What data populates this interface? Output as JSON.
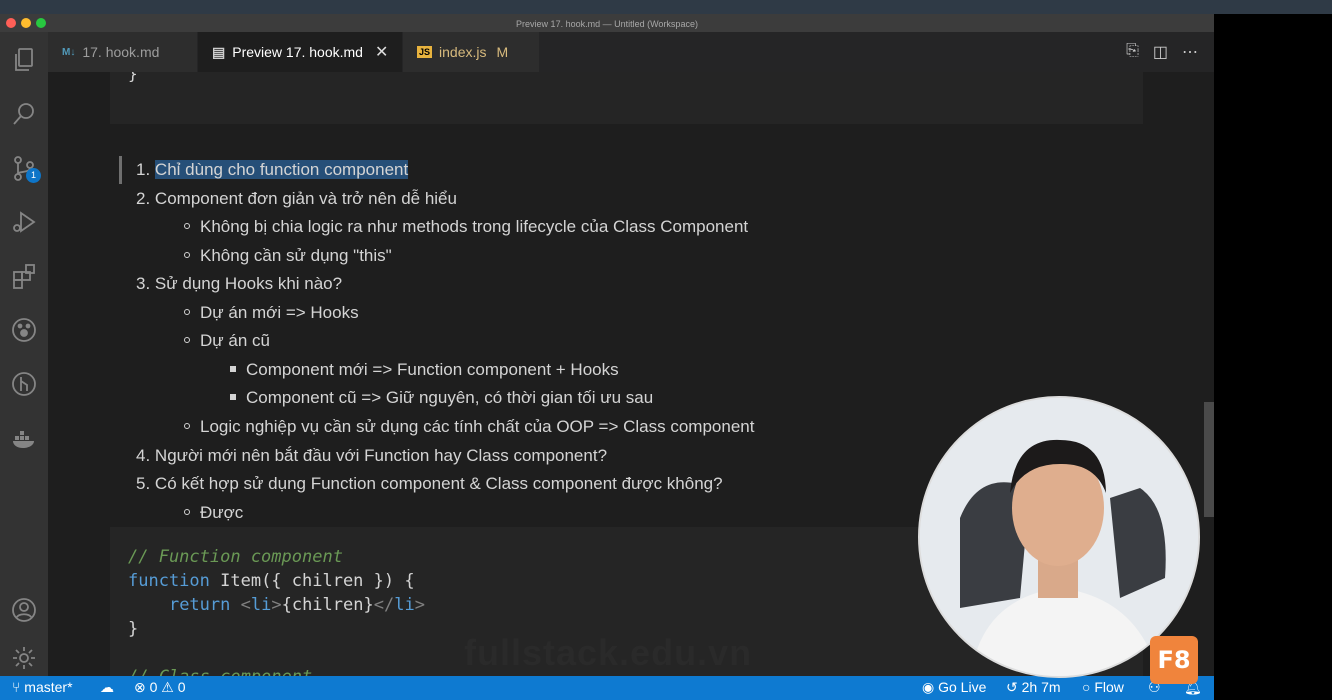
{
  "window": {
    "title": "Preview 17. hook.md — Untitled (Workspace)"
  },
  "tabs": [
    {
      "icon": "M↓",
      "label": "17. hook.md"
    },
    {
      "icon": "▤",
      "label": "Preview 17. hook.md",
      "close": "✕"
    },
    {
      "icon": "JS",
      "label": "index.js",
      "modified": "M"
    }
  ],
  "activity": {
    "source_control_badge": "1"
  },
  "content": {
    "items": [
      {
        "num": "1.",
        "text": "Chỉ dùng cho function component"
      },
      {
        "num": "2.",
        "text": "Component đơn giản và trở nên dễ hiểu"
      },
      {
        "text": "Không bị chia logic ra như methods trong lifecycle của Class Component"
      },
      {
        "text": "Không cần sử dụng \"this\""
      },
      {
        "num": "3.",
        "text": "Sử dụng Hooks khi nào?"
      },
      {
        "text": "Dự án mới => Hooks"
      },
      {
        "text": "Dự án cũ"
      },
      {
        "text": "Component mới => Function component + Hooks"
      },
      {
        "text": "Component cũ => Giữ nguyên, có thời gian tối ưu sau"
      },
      {
        "text": "Logic nghiệp vụ cần sử dụng các tính chất của OOP => Class component"
      },
      {
        "num": "4.",
        "text": "Người mới nên bắt đầu với Function hay Class component?"
      },
      {
        "num": "5.",
        "text": "Có kết hợp sử dụng Function component & Class component được không?"
      },
      {
        "text": "Được"
      }
    ],
    "code": {
      "comment1": "// Function component",
      "kw_function": "function",
      "fn_sig": " Item({ chilren }) {",
      "indent": "    ",
      "kw_return": "return",
      "tag_open_lt": " <",
      "tag_li": "li",
      "gt": ">",
      "expr": "{chilren}",
      "tag_close_lt": "</",
      "tag_li2": "li",
      "gt2": ">",
      "close_brace": "}",
      "comment2": "// Class component"
    },
    "top_brace": "}"
  },
  "watermark": "fullstack.edu.vn",
  "overlay_logo": "F8",
  "status": {
    "branch": "master*",
    "errors": "0",
    "warnings": "0",
    "golive": "Go Live",
    "time": "2h 7m",
    "flow": "Flow"
  }
}
